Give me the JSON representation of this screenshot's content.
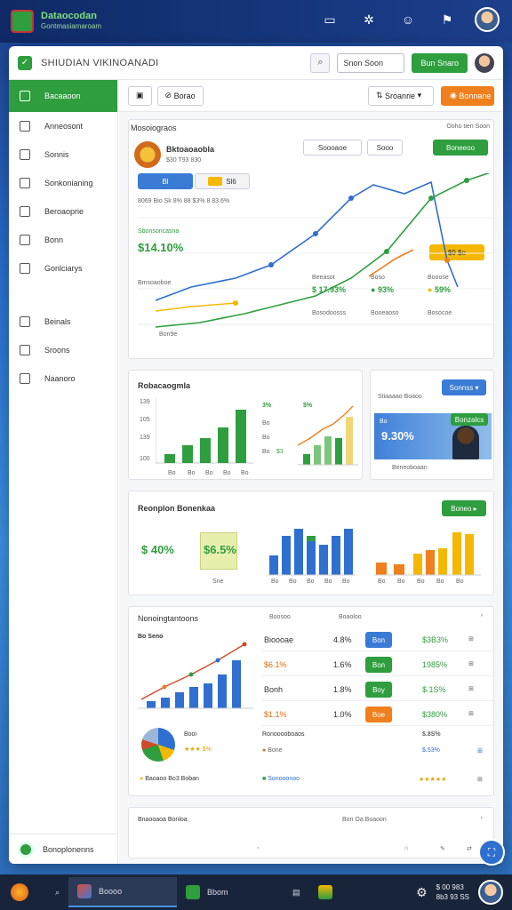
{
  "topbar": {
    "brand": "Dataocodan",
    "brand_sub": "Gontmasiamaroam"
  },
  "window": {
    "title": "SHIUDIAN VIKINOANADI",
    "search_label": "Snon Soon",
    "green_button": "Bun Snaro"
  },
  "sidebar": {
    "items": [
      {
        "label": "Bacaaoon"
      },
      {
        "label": "Anneosont"
      },
      {
        "label": "Sonnis"
      },
      {
        "label": "Sonkonianing"
      },
      {
        "label": "Beroaoprie"
      },
      {
        "label": "Bonn"
      },
      {
        "label": "Gonlciarys"
      },
      {
        "label": "Beinals"
      },
      {
        "label": "Sroons"
      },
      {
        "label": "Naanoro"
      }
    ],
    "bottom_label": "Bonoplonenns"
  },
  "toolbar": {
    "btn2": "Borao",
    "select": "Sroanrie",
    "orange": "Bonnane"
  },
  "main": {
    "section_title": "Mosoiograos",
    "section_right": "Ooho tien Soon",
    "card1": {
      "title": "Bktoaoaobla",
      "sub": "$30 T93 830",
      "btn_a": "Soooaoe",
      "btn_b": "Sooo",
      "btn_c": "Boneeoo",
      "tab1": "Bl",
      "tab2": "Sl6",
      "legend_text": "8069 Bio  Sk 8% 88 $3% 8 83.6%",
      "green_label": "Sbonsoncasna",
      "green_value": "$14.10%",
      "side_label": "Bmsoaoboe",
      "marker_label": "Bon9e",
      "yellow_btn": "$9 $e",
      "stats": [
        {
          "label": "Beeasot",
          "value": "$ 17.93%",
          "sub": "Bosodoosss"
        },
        {
          "label": "Boso",
          "value": "93%",
          "sub": "Booeaoso"
        },
        {
          "label": "Booose",
          "value": "59%",
          "sub": "Bosocoe"
        }
      ]
    },
    "card2": {
      "title": "Robacaogmla",
      "y_ticks": [
        "139",
        "105",
        "139",
        "100"
      ],
      "x_ticks": [
        "Bo",
        "Bo",
        "Bo",
        "Bo",
        "Bo"
      ],
      "mini_top1": "3%",
      "mini_top2": "$%",
      "mini_rows": [
        "Bo",
        "Bo",
        "Bo",
        "$3"
      ]
    },
    "card3": {
      "title": "Stiaaaao Boaoo",
      "button": "Sonnss",
      "pct": "9.30%",
      "tag": "Bonzalcs",
      "subtag": "Bo",
      "foot": "Beneoboaan"
    },
    "card4": {
      "title": "Reonplon Bonenkaa",
      "btn": "Boneo",
      "v1": "$ 40%",
      "v2": "$6.5%",
      "v1_sub": "Sne",
      "x_labels": [
        "Bo",
        "Bo",
        "Bo",
        "Bo",
        "Bo"
      ]
    },
    "card5": {
      "title": "Nonoingtantoons",
      "sub": "Bo Seno",
      "col1": "Boosoo",
      "col2": "Boaoloo",
      "rows": [
        {
          "name": "Bioooae",
          "p1": "4.8%",
          "badge": "Bon",
          "p2": "$3B3%",
          "bc": "b"
        },
        {
          "name": "$6.1%",
          "p1": "1.6%",
          "badge": "Bon",
          "p2": "1985%",
          "bc": "g"
        },
        {
          "name": "Bonh",
          "p1": "1.8%",
          "badge": "Boy",
          "p2": "$.1S%",
          "bc": "g"
        },
        {
          "name": "$1.1%",
          "p1": "1.0%",
          "badge": "Boe",
          "p2": "$380%",
          "bc": "o"
        }
      ],
      "pie_label": "Booi",
      "pie_sub": "$%",
      "ring_title": "Ronooooboaos",
      "ring_val": "$.8S%",
      "ring2_label": "Bone",
      "ring2_val": "$.53%",
      "foot_left": "Baoaoo Bo3 Boban",
      "foot_mid": "Sonooonoo"
    },
    "card6": {
      "title": "Bnaooaoa Bonloa",
      "right": "Bon Oa Boaoon"
    }
  },
  "taskbar": {
    "item1": "Boooo",
    "item2": "Bbom",
    "time": "$ 00 983",
    "date": "8b3 93 SS"
  }
}
